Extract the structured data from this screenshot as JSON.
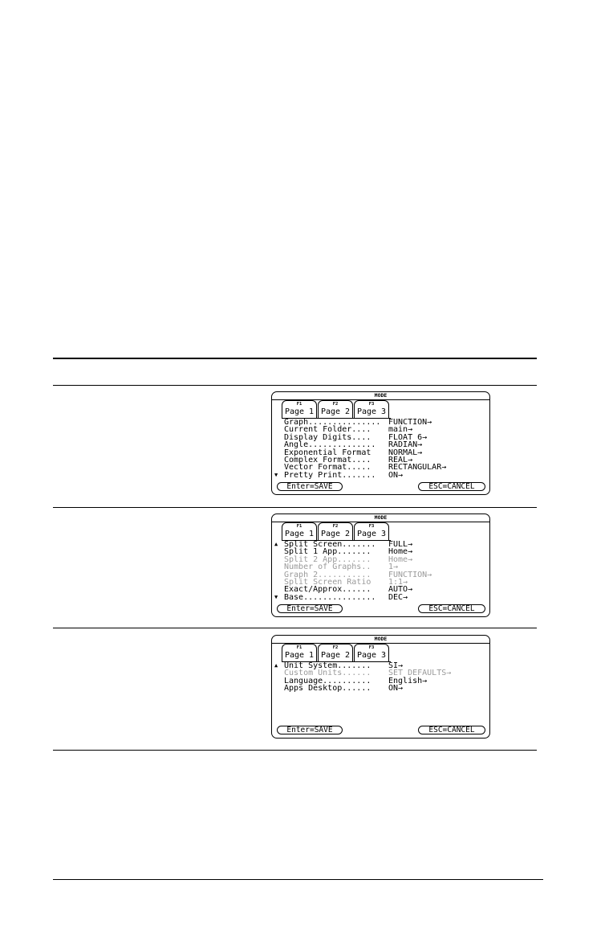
{
  "screens": [
    {
      "title": "MODE",
      "tabs": [
        {
          "key": "F1",
          "label": "Page 1"
        },
        {
          "key": "F2",
          "label": "Page 2"
        },
        {
          "key": "F3",
          "label": "Page 3"
        }
      ],
      "active_tab": 1,
      "rows": [
        {
          "arrow": "",
          "label": "Graph...............",
          "value": "FUNCTION→",
          "dim": false
        },
        {
          "arrow": "",
          "label": "Current Folder....",
          "value": "main→",
          "dim": false
        },
        {
          "arrow": "",
          "label": "Display Digits....",
          "value": "FLOAT 6→",
          "dim": false
        },
        {
          "arrow": "",
          "label": "Angle..............",
          "value": "RADIAN→",
          "dim": false
        },
        {
          "arrow": "",
          "label": "Exponential Format",
          "value": "NORMAL→",
          "dim": false
        },
        {
          "arrow": "",
          "label": "Complex Format....",
          "value": "REAL→",
          "dim": false
        },
        {
          "arrow": "",
          "label": "Vector Format.....",
          "value": "RECTANGULAR→",
          "dim": false
        },
        {
          "arrow": "▼",
          "label": "Pretty Print.......",
          "value": "ON→",
          "dim": false
        }
      ],
      "save_label": "Enter=SAVE",
      "cancel_label": "ESC=CANCEL"
    },
    {
      "title": "MODE",
      "tabs": [
        {
          "key": "F1",
          "label": "Page 1"
        },
        {
          "key": "F2",
          "label": "Page 2"
        },
        {
          "key": "F3",
          "label": "Page 3"
        }
      ],
      "active_tab": 2,
      "rows": [
        {
          "arrow": "▲",
          "label": "Split Screen.......",
          "value": "FULL→",
          "dim": false
        },
        {
          "arrow": "",
          "label": "Split 1 App.......",
          "value": "Home→",
          "dim": false
        },
        {
          "arrow": "",
          "label": "Split 2 App.......",
          "value": "Home→",
          "dim": true
        },
        {
          "arrow": "",
          "label": "Number of Graphs..",
          "value": "1→",
          "dim": true
        },
        {
          "arrow": "",
          "label": "Graph 2...........",
          "value": "FUNCTION→",
          "dim": true
        },
        {
          "arrow": "",
          "label": "Split Screen Ratio",
          "value": "1:1→",
          "dim": true
        },
        {
          "arrow": "",
          "label": "Exact/Approx......",
          "value": "AUTO→",
          "dim": false
        },
        {
          "arrow": "▼",
          "label": "Base...............",
          "value": "DEC→",
          "dim": false
        }
      ],
      "save_label": "Enter=SAVE",
      "cancel_label": "ESC=CANCEL"
    },
    {
      "title": "MODE",
      "tabs": [
        {
          "key": "F1",
          "label": "Page 1"
        },
        {
          "key": "F2",
          "label": "Page 2"
        },
        {
          "key": "F3",
          "label": "Page 3"
        }
      ],
      "active_tab": 3,
      "rows": [
        {
          "arrow": "▲",
          "label": "Unit System.......",
          "value": "SI→",
          "dim": false
        },
        {
          "arrow": "",
          "label": "Custom Units......",
          "value": "SET DEFAULTS→",
          "dim": true
        },
        {
          "arrow": "",
          "label": "Language..........",
          "value": "English→",
          "dim": false
        },
        {
          "arrow": "",
          "label": "Apps Desktop......",
          "value": "ON→",
          "dim": false
        }
      ],
      "save_label": "Enter=SAVE",
      "cancel_label": "ESC=CANCEL"
    }
  ]
}
